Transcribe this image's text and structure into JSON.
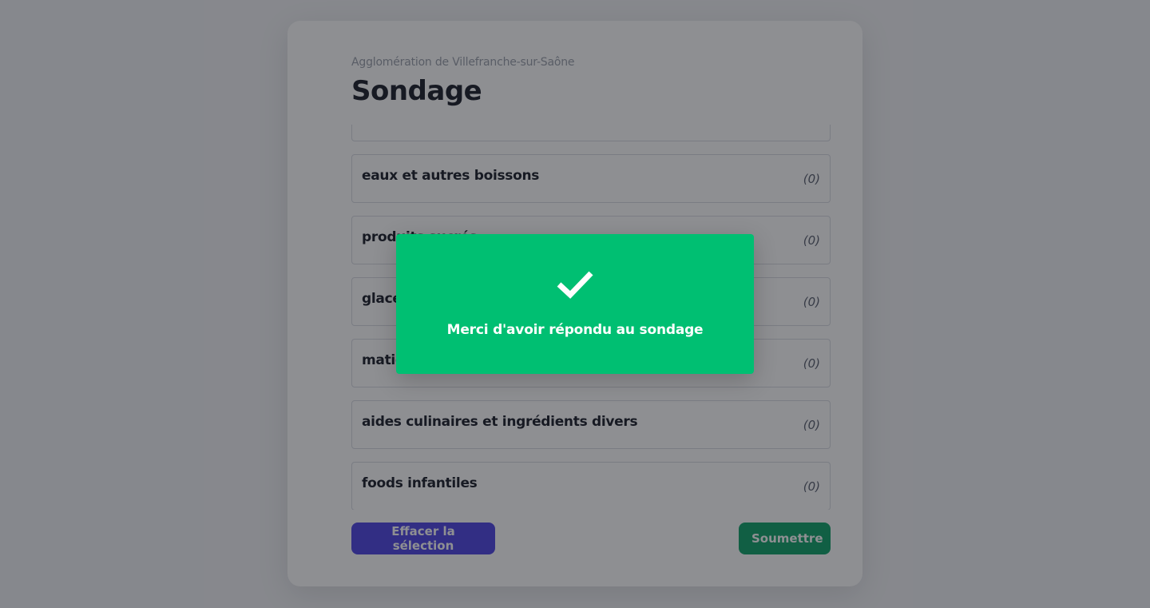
{
  "survey": {
    "organization": "Agglomération de Villefranche-sur-Saône",
    "title": "Sondage",
    "categories": [
      {
        "label": "",
        "count": ""
      },
      {
        "label": "eaux et autres boissons",
        "count": "(0)"
      },
      {
        "label": "produits sucrés",
        "count": "(0)"
      },
      {
        "label": "glaces",
        "count": "(0)"
      },
      {
        "label": "matières grasses",
        "count": "(0)"
      },
      {
        "label": "aides culinaires et ingrédients divers",
        "count": "(0)"
      },
      {
        "label": "foods infantiles",
        "count": "(0)"
      }
    ],
    "clear_button": "Effacer la sélection",
    "submit_button": "Soumettre"
  },
  "modal": {
    "icon": "checkmark-icon",
    "message": "Merci d'avoir répondu au sondage",
    "color": "#00bf72"
  },
  "colors": {
    "clear_button": "#4f46e5",
    "submit_button": "#10a36a"
  }
}
